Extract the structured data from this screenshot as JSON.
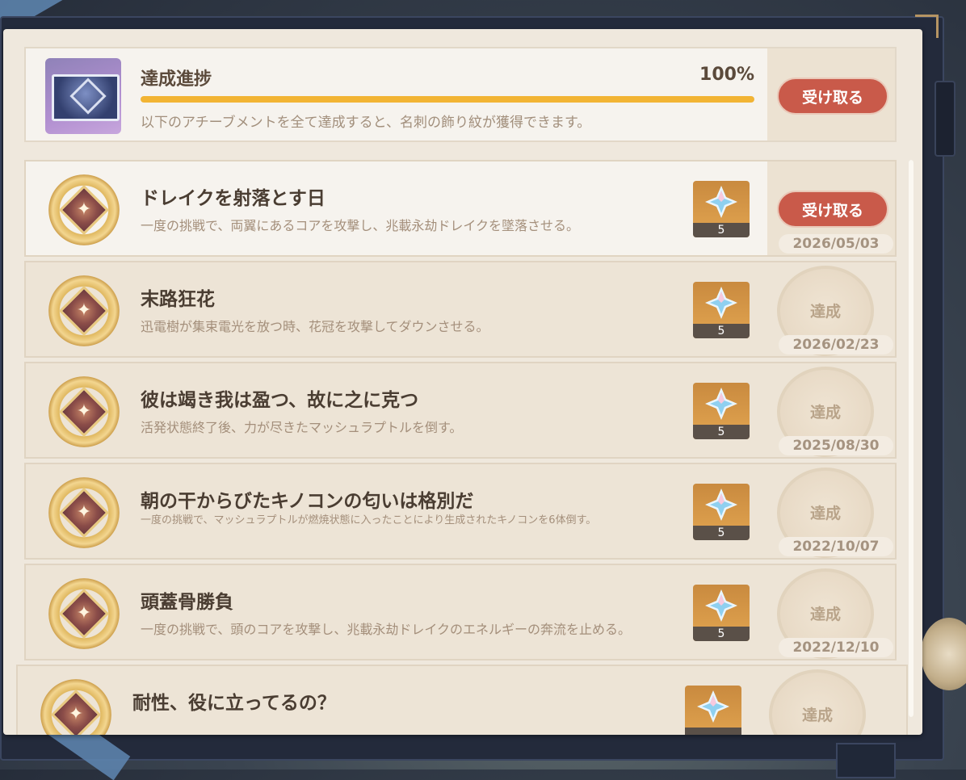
{
  "progress": {
    "title": "達成進捗",
    "percent_text": "100%",
    "percent_value": 100,
    "description": "以下のアチーブメントを全て達成すると、名刺の飾り紋が獲得できます。",
    "claim_label": "受け取る"
  },
  "achievements": [
    {
      "title": "ドレイクを射落とす日",
      "description": "一度の挑戦で、両翼にあるコアを攻撃し、兆載永劫ドレイクを墜落させる。",
      "reward_count": "5",
      "status": "受け取る",
      "date": "2026/05/03"
    },
    {
      "title": "末路狂花",
      "description": "迅電樹が集束電光を放つ時、花冠を攻撃してダウンさせる。",
      "reward_count": "5",
      "status": "達成",
      "date": "2026/02/23"
    },
    {
      "title": "彼は竭き我は盈つ、故に之に克つ",
      "description": "活発状態終了後、力が尽きたマッシュラプトルを倒す。",
      "reward_count": "5",
      "status": "達成",
      "date": "2025/08/30"
    },
    {
      "title": "朝の干からびたキノコンの匂いは格別だ",
      "description": "一度の挑戦で、マッシュラプトルが燃焼状態に入ったことにより生成されたキノコンを6体倒す。",
      "reward_count": "5",
      "status": "達成",
      "date": "2022/10/07"
    },
    {
      "title": "頭蓋骨勝負",
      "description": "一度の挑戦で、頭のコアを攻撃し、兆載永劫ドレイクのエネルギーの奔流を止める。",
      "reward_count": "5",
      "status": "達成",
      "date": "2022/12/10"
    },
    {
      "title": "耐性、役に立ってるの？",
      "description": "",
      "reward_count": "",
      "status": "達成",
      "date": ""
    }
  ],
  "colors": {
    "accent_button": "#c95a4a",
    "progress_fill": "#f2b433"
  }
}
